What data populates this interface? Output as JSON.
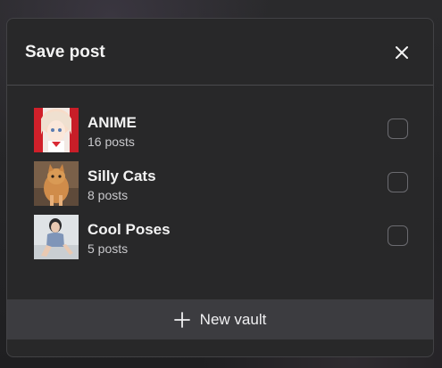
{
  "modal": {
    "title": "Save post",
    "close_icon": "close-icon"
  },
  "vaults": [
    {
      "name": "ANIME",
      "count": "16 posts",
      "thumbnail": "anime-girl-thumbnail",
      "checked": false
    },
    {
      "name": "Silly Cats",
      "count": "8 posts",
      "thumbnail": "cat-thumbnail",
      "checked": false
    },
    {
      "name": "Cool Poses",
      "count": "5 posts",
      "thumbnail": "person-pose-thumbnail",
      "checked": false
    }
  ],
  "footer": {
    "new_vault_label": "New vault",
    "icon": "plus-icon"
  },
  "colors": {
    "modal_bg": "#282829",
    "footer_bg": "#3c3c40",
    "text_primary": "#f3f3f3",
    "text_secondary": "#c9c9cc",
    "checkbox_border": "#6b6b70"
  }
}
